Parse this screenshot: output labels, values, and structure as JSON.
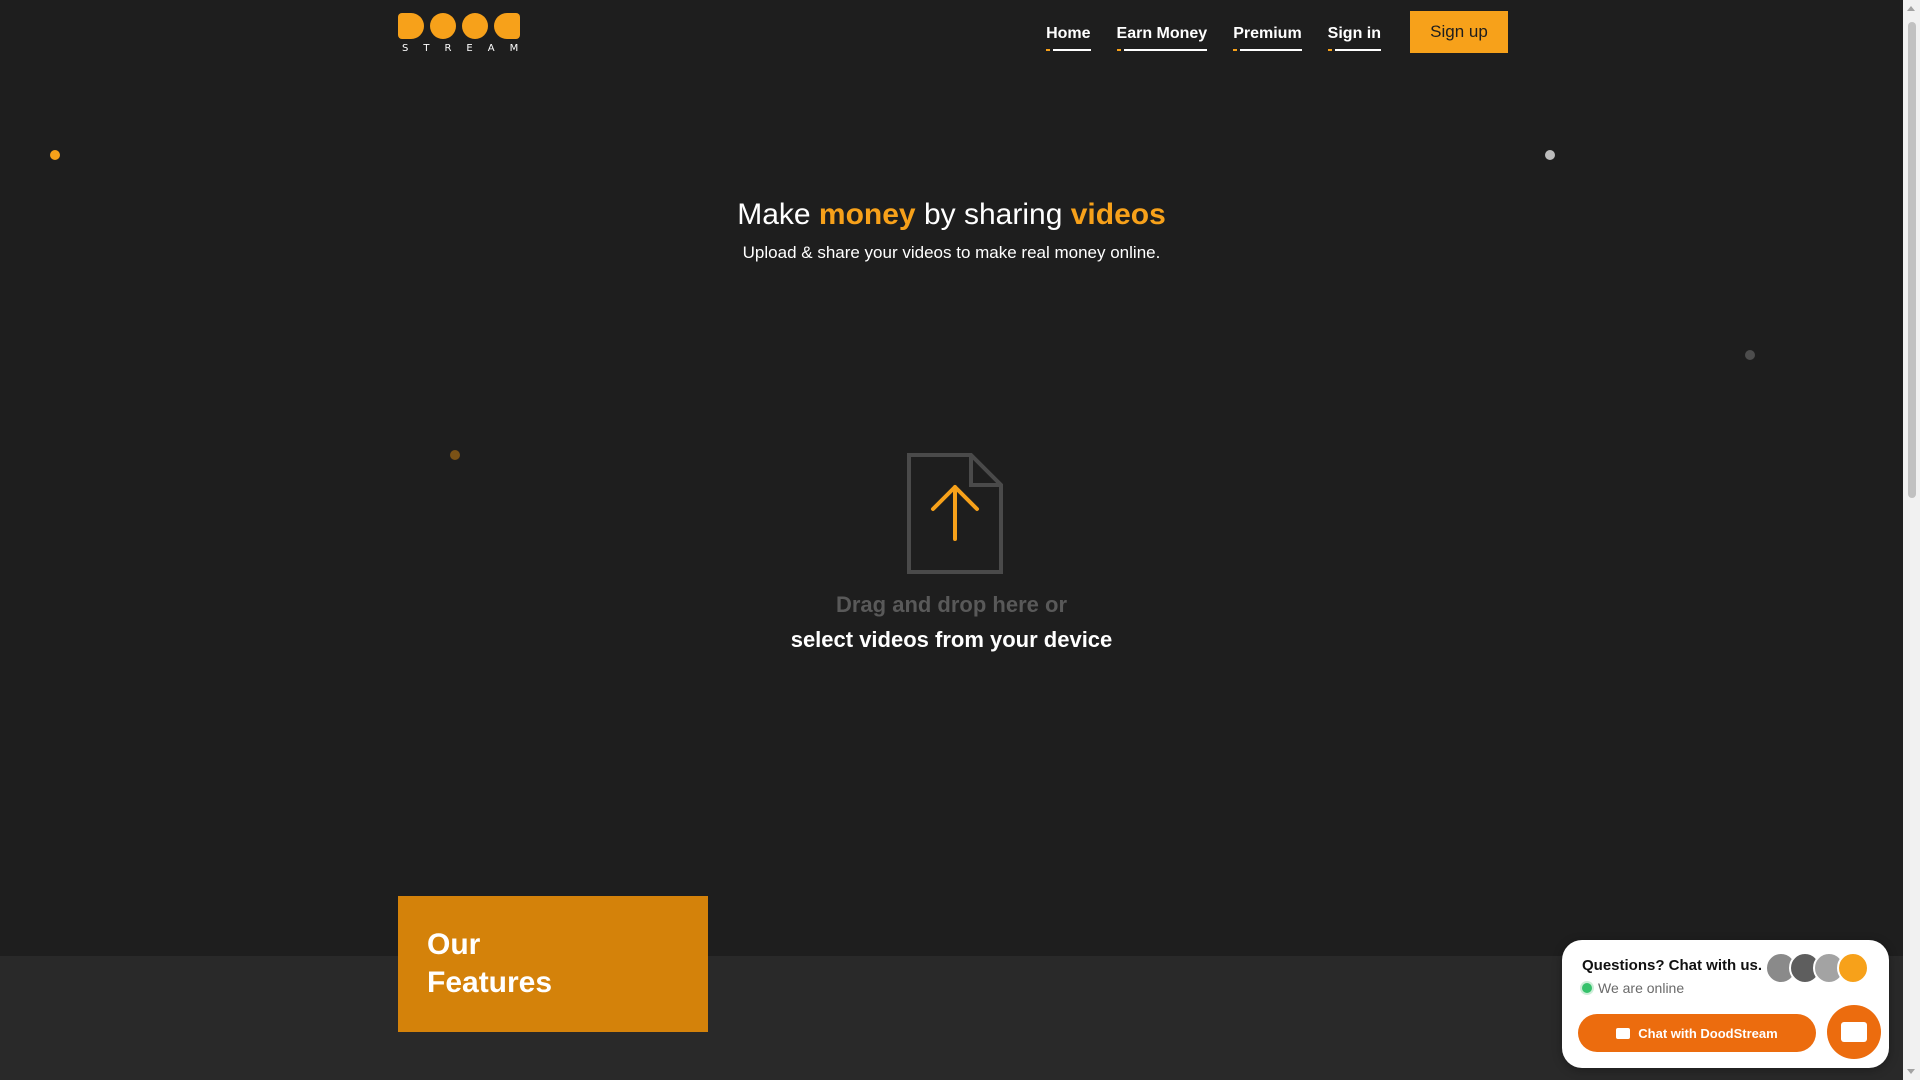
{
  "brand": {
    "logo_text": "STREAM",
    "accent": "#f7a11a"
  },
  "nav": {
    "items": [
      {
        "label": "Home"
      },
      {
        "label": "Earn Money"
      },
      {
        "label": "Premium"
      },
      {
        "label": "Sign in"
      }
    ],
    "signup_label": "Sign up"
  },
  "hero": {
    "title_pre": "Make ",
    "title_hl1": "money",
    "title_mid": " by sharing ",
    "title_hl2": "videos",
    "subtitle": "Upload & share your videos to make real money online."
  },
  "upload": {
    "icon": "upload-file-icon",
    "drop_text": "Drag and drop here or",
    "select_text": "select videos from your device"
  },
  "features": {
    "line1": "Our",
    "line2": "Features"
  },
  "chat": {
    "question": "Questions? Chat with us.",
    "status": "We are online",
    "button_label": "Chat with DoodStream"
  }
}
